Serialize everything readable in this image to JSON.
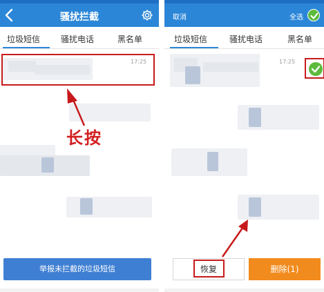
{
  "left_screen": {
    "title": "骚扰拦截",
    "tabs": [
      {
        "label": "垃圾短信"
      },
      {
        "label": "骚扰电话"
      },
      {
        "label": "黑名单"
      }
    ],
    "message_time": "17:25",
    "annotation": "长按",
    "report_button": "举报未拦截的垃圾短信"
  },
  "right_screen": {
    "cancel": "取消",
    "select_all": "全选",
    "tabs": [
      {
        "label": "垃圾短信"
      },
      {
        "label": "骚扰电话"
      },
      {
        "label": "黑名单"
      }
    ],
    "message_time": "17:25",
    "restore_button": "恢复",
    "delete_button": "删除(1)"
  },
  "colors": {
    "title_bar": "#2b86d8",
    "accent_red": "#c7191b",
    "check_green": "#5cbb3c",
    "delete_orange": "#f28b1d",
    "report_blue": "#3f7fd3"
  }
}
